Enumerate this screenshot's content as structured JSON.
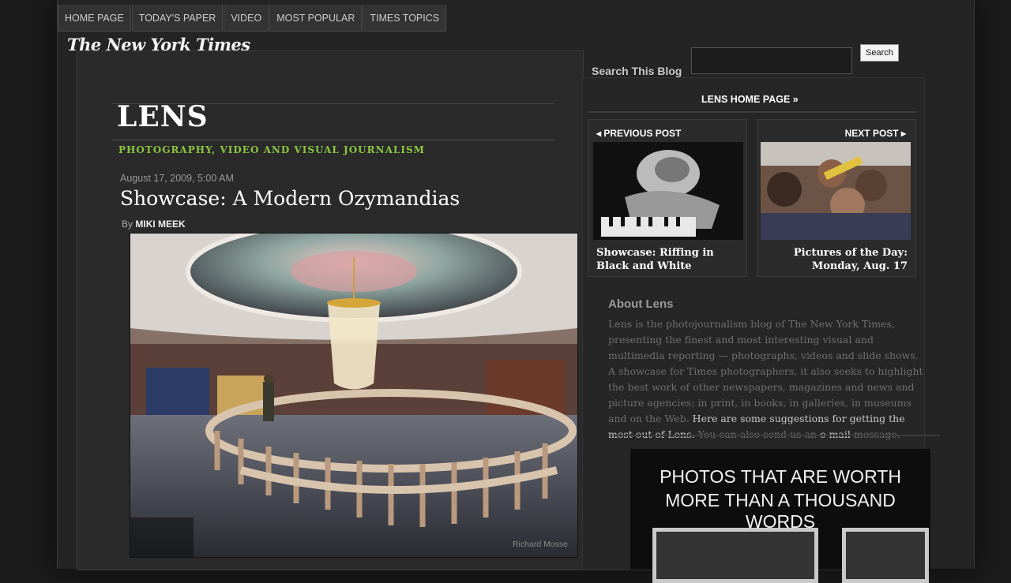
{
  "nav": {
    "items": [
      "HOME PAGE",
      "TODAY'S PAPER",
      "VIDEO",
      "MOST POPULAR",
      "TIMES TOPICS"
    ]
  },
  "brand": {
    "nyt_logo": "The New York Times"
  },
  "lens": {
    "logo": "LENS",
    "tagline": "PHOTOGRAPHY, VIDEO AND VISUAL JOURNALISM"
  },
  "post": {
    "date": "August 17, 2009, 5:00 AM",
    "title": "Showcase: A Modern Ozymandias",
    "by_prefix": "By",
    "author": "MIKI MEEK",
    "photo_credit": "Richard Mosse"
  },
  "search": {
    "label": "Search This Blog",
    "button": "Search",
    "value": ""
  },
  "sidebar": {
    "home_link": "LENS HOME PAGE »",
    "previous": {
      "label": "PREVIOUS POST",
      "caption": "Showcase: Riffing in Black and White"
    },
    "next": {
      "label": "NEXT POST",
      "caption": "Pictures of the Day: Monday, Aug. 17"
    },
    "about": {
      "title": "About Lens",
      "text_1": "Lens is the photojournalism blog of The New York Times, presenting the finest and most interesting visual and multimedia reporting — photographs, videos and slide shows. A showcase for Times photographers, it also seeks to highlight the best work of other newspapers, magazines and news and picture agencies; in print, in books, in galleries, in museums and on the Web.",
      "link_1": "Here are some suggestions for getting the most out of Lens.",
      "text_2": "You can also send us an",
      "link_2": "e-mail",
      "text_3": "message."
    },
    "promo": {
      "line1": "PHOTOS THAT ARE WORTH",
      "line2": "MORE THAN A THOUSAND WORDS"
    }
  },
  "colors": {
    "accent_green": "#8cc63f",
    "background": "#1b1b1b",
    "panel": "#242424"
  },
  "icons": {
    "arrow_left": "triangle-left-icon",
    "arrow_right": "triangle-right-icon"
  }
}
